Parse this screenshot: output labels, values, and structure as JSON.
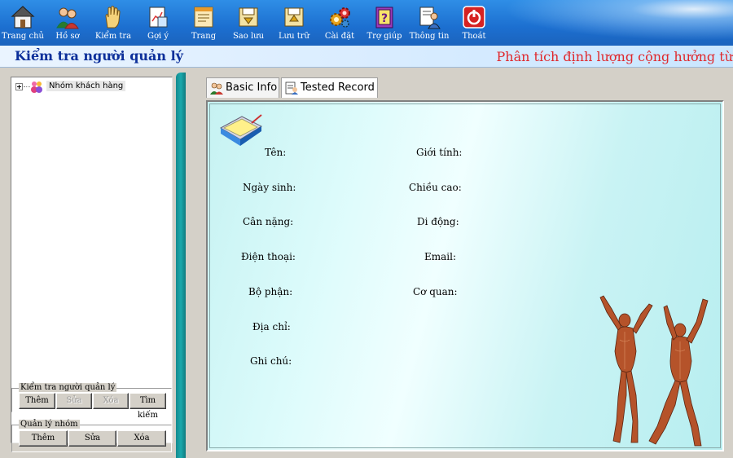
{
  "toolbar": {
    "items": [
      {
        "label": "Trang chủ",
        "icon": "home-icon"
      },
      {
        "label": "Hồ sơ",
        "icon": "users-icon"
      },
      {
        "label": "Kiểm tra",
        "icon": "hand-icon"
      },
      {
        "label": "Gợi ý",
        "icon": "document-chart-icon"
      },
      {
        "label": "Trang",
        "icon": "page-icon"
      },
      {
        "label": "Sao lưu",
        "icon": "backup-icon"
      },
      {
        "label": "Lưu trữ",
        "icon": "archive-icon"
      },
      {
        "label": "Cài đặt",
        "icon": "gears-icon"
      },
      {
        "label": "Trợ giúp",
        "icon": "help-book-icon"
      },
      {
        "label": "Thông tin",
        "icon": "info-person-icon"
      },
      {
        "label": "Thoát",
        "icon": "power-icon"
      }
    ]
  },
  "titlebar": {
    "left": "Kiểm tra người quản lý",
    "right": "Phân tích định lượng cộng hưởng từ"
  },
  "tree": {
    "root_label": "Nhóm khách hàng"
  },
  "admin_group": {
    "legend": "Kiểm tra người quản lý",
    "buttons": {
      "add": "Thêm",
      "edit": "Sửa",
      "delete": "Xóa",
      "search": "Tìm kiếm"
    }
  },
  "group_mgmt": {
    "legend": "Quản lý nhóm",
    "buttons": {
      "add": "Thêm",
      "edit": "Sửa",
      "delete": "Xóa"
    }
  },
  "tabs": {
    "basic": "Basic Info",
    "tested": "Tested Record"
  },
  "fields": {
    "name": "Tên:",
    "gender": "Giới tính:",
    "dob": "Ngày sinh:",
    "height": "Chiều cao:",
    "weight": "Cân nặng:",
    "mobile": "Di động:",
    "phone": "Điện thoại:",
    "email": "Email:",
    "department": "Bộ phận:",
    "organization": "Cơ quan:",
    "address": "Địa chỉ:",
    "notes": "Ghi chú:"
  },
  "colors": {
    "toolbar": "#1c6fd0",
    "title_left": "#0c2f9a",
    "title_right": "#e0282c",
    "splitter": "#1ba9ad",
    "content_bg": "#dcfbfb"
  }
}
